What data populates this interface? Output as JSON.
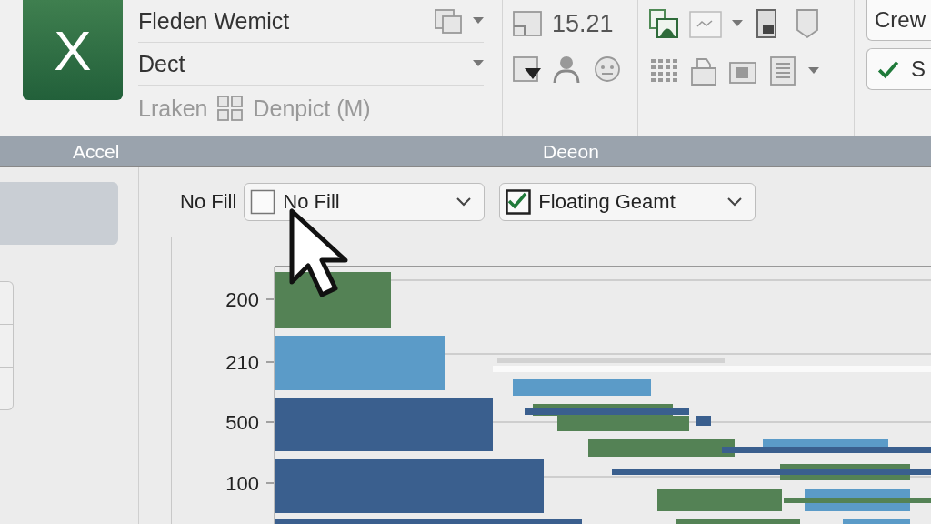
{
  "ribbon": {
    "logo_letter": "X",
    "name_dropdown": {
      "value": "Fleden Wemict"
    },
    "style_dropdown": {
      "value": "Dect"
    },
    "info_items": [
      {
        "label": "Lraken",
        "disabled": true
      },
      {
        "label": "Denpict (M)",
        "disabled": true
      }
    ],
    "size_value": "15.21",
    "buttons": [
      {
        "label": "Crew",
        "checked": false
      },
      {
        "label": "S",
        "checked": true
      }
    ],
    "group_labels": [
      "Accel",
      "Deeon"
    ]
  },
  "format_bar": {
    "fill_label": "No Fill",
    "fill_dropdown": {
      "value": "No Fill",
      "checked": false
    },
    "float_dropdown": {
      "value": "Floating Geamt",
      "checked": true
    }
  },
  "chart": {
    "axis_labels": [
      "200",
      "210",
      "500",
      "100"
    ]
  }
}
